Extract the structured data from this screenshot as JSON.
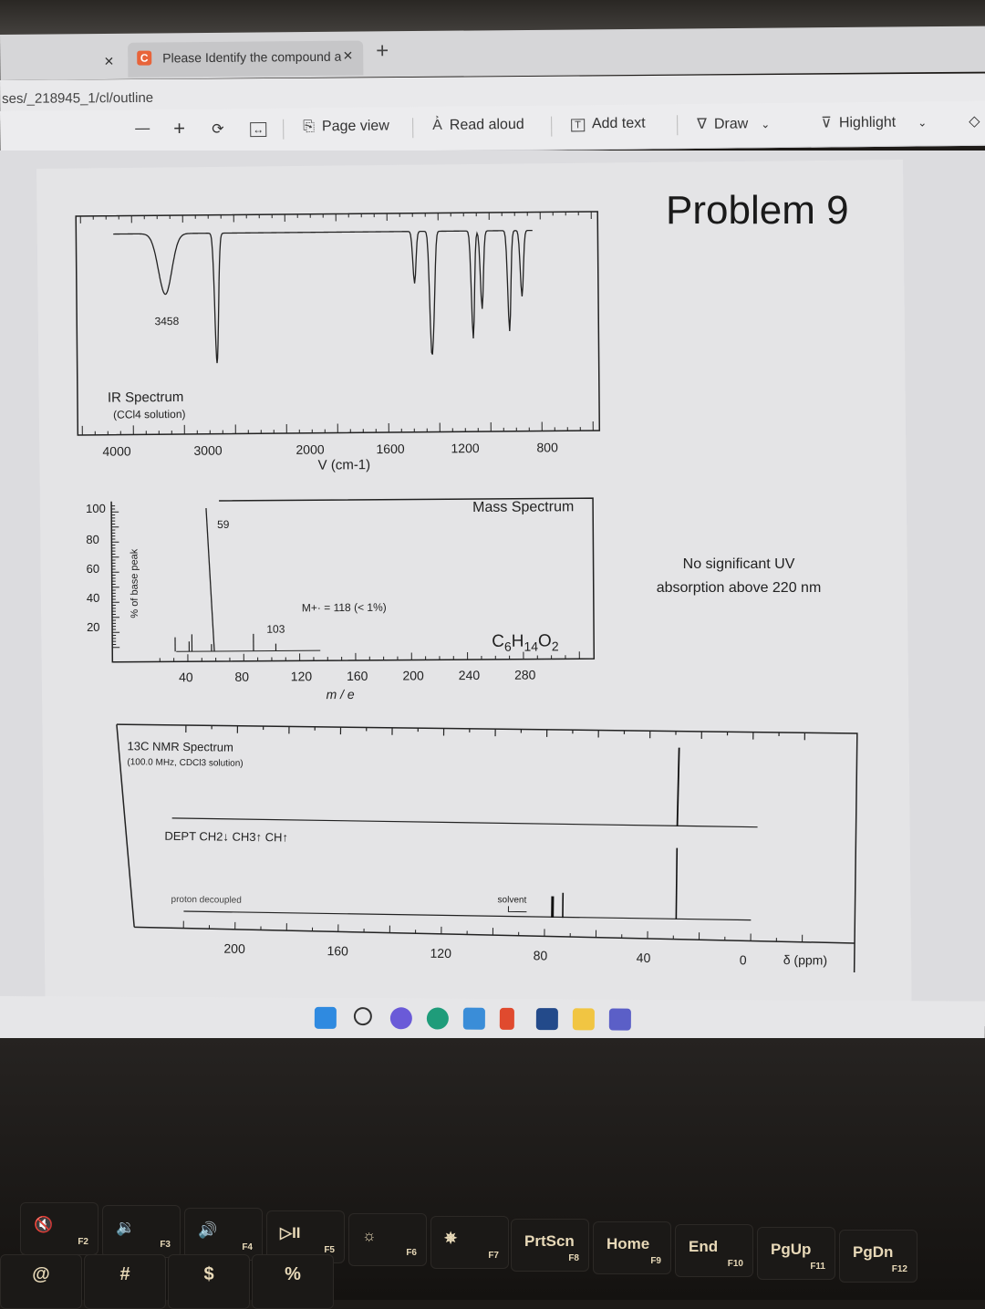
{
  "browser": {
    "tab_close_prev": "×",
    "tab": {
      "favicon": "C",
      "title": "Please Identify the compound ar",
      "close": "×"
    },
    "new_tab": "+",
    "url": "ses/_218945_1/cl/outline"
  },
  "pdf_toolbar": {
    "zoom_out": "—",
    "zoom_in": "+",
    "rotate_icon": "rotate-icon",
    "fit_icon": "fit-width-icon",
    "page_view": "Page view",
    "read_aloud": "Read aloud",
    "add_text": "Add text",
    "draw": "Draw",
    "highlight": "Highlight",
    "eraser_icon": "eraser-icon"
  },
  "document": {
    "problem_title": "Problem 9",
    "uv_note_line1": "No significant UV",
    "uv_note_line2": "absorption above 220 nm"
  },
  "chart_data": [
    {
      "type": "line",
      "title": "IR Spectrum",
      "subtitle": "(CCl4 solution)",
      "xlabel": "V (cm-1)",
      "ylabel": "",
      "x_ticks": [
        "4000",
        "3000",
        "2000",
        "1600",
        "1200",
        "800"
      ],
      "annotations": [
        "3458"
      ],
      "peaks_cm-1": [
        {
          "x": 3458,
          "depth": 0.35,
          "label": "3458"
        },
        {
          "x": 2970,
          "depth": 0.75
        },
        {
          "x": 1470,
          "depth": 0.3
        },
        {
          "x": 1380,
          "depth": 0.62
        },
        {
          "x": 1365,
          "depth": 0.38
        },
        {
          "x": 1150,
          "depth": 0.62
        },
        {
          "x": 1100,
          "depth": 0.45
        },
        {
          "x": 950,
          "depth": 0.58
        },
        {
          "x": 880,
          "depth": 0.38
        }
      ]
    },
    {
      "type": "bar",
      "title": "Mass Spectrum",
      "xlabel": "m / e",
      "ylabel": "% of base peak",
      "ylim": [
        0,
        100
      ],
      "y_ticks": [
        "100",
        "80",
        "60",
        "40",
        "20"
      ],
      "x_ticks": [
        "40",
        "80",
        "120",
        "160",
        "200",
        "240",
        "280"
      ],
      "peaks": [
        {
          "mz": 31,
          "intensity": 10
        },
        {
          "mz": 41,
          "intensity": 7
        },
        {
          "mz": 43,
          "intensity": 12
        },
        {
          "mz": 57,
          "intensity": 5
        },
        {
          "mz": 59,
          "intensity": 100,
          "label": "59"
        },
        {
          "mz": 87,
          "intensity": 12
        },
        {
          "mz": 103,
          "intensity": 5,
          "label": "103"
        }
      ],
      "annotations": [
        "M+· = 118 (< 1%)"
      ],
      "formula": "C6H14O2"
    },
    {
      "type": "line",
      "title": "13C NMR Spectrum",
      "subtitle": "(100.0 MHz, CDCl3 solution)",
      "xlabel": "δ (ppm)",
      "x_ticks": [
        "200",
        "160",
        "120",
        "80",
        "40",
        "0"
      ],
      "dept_label": "DEPT  CH2↓ CH3↑ CH↑",
      "proton_label": "proton decoupled",
      "solvent_label": "solvent",
      "dept_peaks_ppm": [
        {
          "ppm": 29,
          "direction": "up"
        }
      ],
      "proton_decoupled_peaks_ppm": [
        {
          "ppm": 77,
          "label": "solvent",
          "height": 0.3
        },
        {
          "ppm": 73,
          "height": 0.35
        },
        {
          "ppm": 29,
          "height": 1.0
        }
      ]
    }
  ],
  "taskbar": {
    "apps": [
      "start-icon",
      "search-icon",
      "chat-icon",
      "edge-icon",
      "mail-icon",
      "office-icon",
      "store-icon",
      "file-explorer-icon",
      "teams-icon"
    ]
  },
  "keyboard": {
    "fkeys": [
      {
        "main": "🔇",
        "fn": "F2"
      },
      {
        "main": "🔉",
        "fn": "F3"
      },
      {
        "main": "🔊",
        "fn": "F4"
      },
      {
        "main": "▷II",
        "fn": "F5"
      },
      {
        "main": "☼",
        "fn": "F6"
      },
      {
        "main": "✵",
        "fn": "F7"
      },
      {
        "main": "PrtScn",
        "fn": "F8"
      },
      {
        "main": "Home",
        "fn": "F9"
      },
      {
        "main": "End",
        "fn": "F10"
      },
      {
        "main": "PgUp",
        "fn": "F11"
      },
      {
        "main": "PgDn",
        "fn": "F12"
      }
    ],
    "number_row": [
      "@",
      "#",
      "$",
      "%"
    ]
  }
}
